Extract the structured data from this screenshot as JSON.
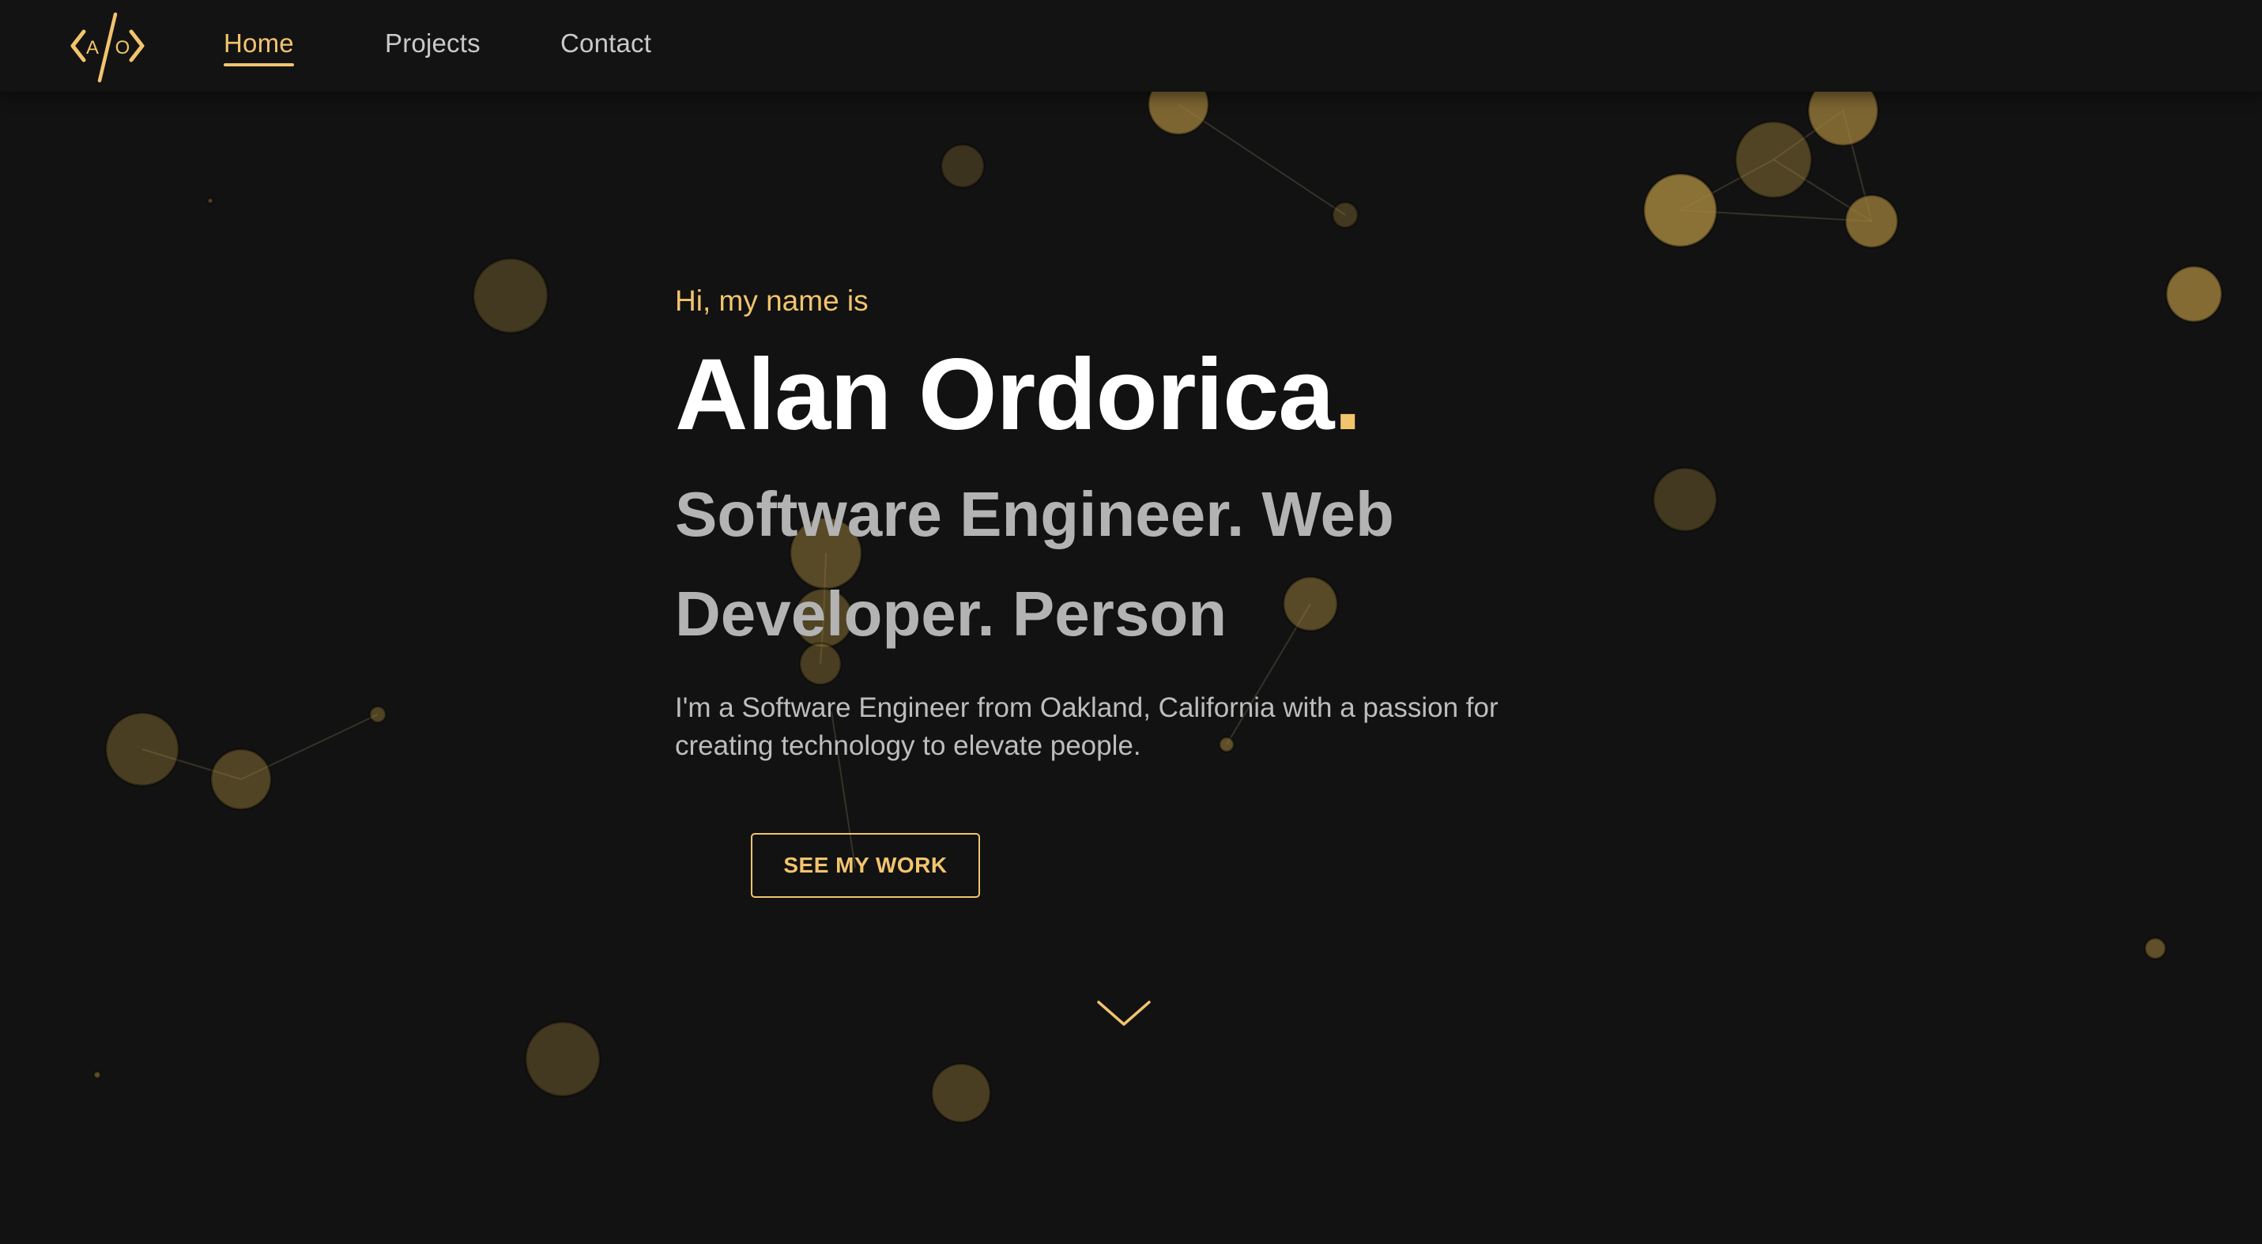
{
  "nav": {
    "logo_letters": "A/O",
    "links": [
      {
        "label": "Home",
        "active": true
      },
      {
        "label": "Projects",
        "active": false
      },
      {
        "label": "Contact",
        "active": false
      }
    ]
  },
  "hero": {
    "greeting": "Hi, my name is",
    "name": "Alan Ordorica",
    "name_punct": ".",
    "tagline": "Software Engineer. Web Developer. Person",
    "bio": "I'm a Software Engineer from Oakland, California with a passion for creating technology to elevate people.",
    "cta_label": "SEE MY WORK"
  },
  "icons": {
    "logo": "code-brackets-logo-icon",
    "scroll": "chevron-down-icon"
  },
  "colors": {
    "background": "#121212",
    "accent": "#f2c46d",
    "heading": "#ffffff",
    "tagline": "#b3b3b3",
    "body_text": "#bdbdbd",
    "particle": "#a0823c"
  }
}
